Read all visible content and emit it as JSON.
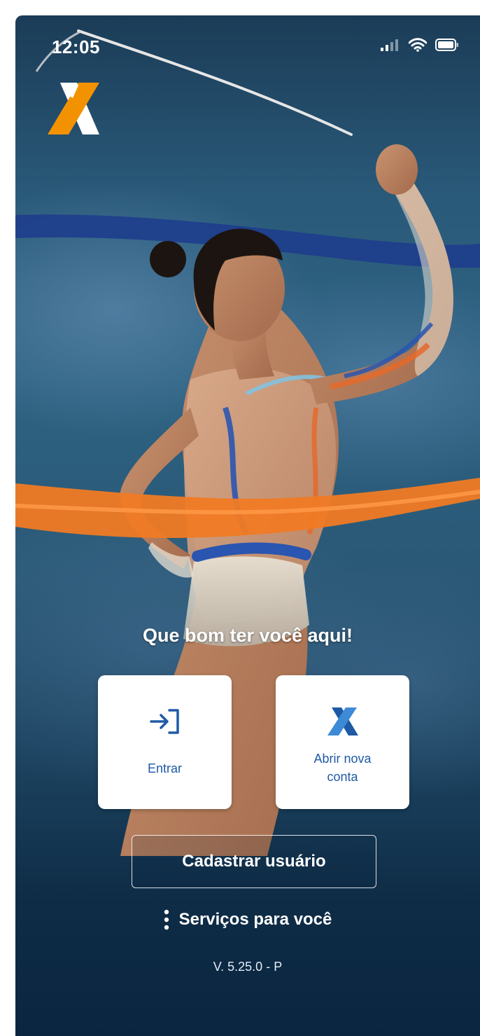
{
  "status_bar": {
    "time": "12:05",
    "icons": [
      "cellular-signal-icon",
      "wifi-icon",
      "battery-icon"
    ]
  },
  "brand": {
    "logo": "caixa-x-logo",
    "colors": {
      "logo_orange": "#f39200",
      "logo_white": "#ffffff",
      "primary_blue": "#1f5aa6",
      "ribbon_orange": "#f07a24",
      "ribbon_blue": "#1e3e8c"
    }
  },
  "main": {
    "greeting": "Que bom ter você aqui!",
    "actions": [
      {
        "label": "Entrar",
        "icon": "login-arrow-icon"
      },
      {
        "label_line1": "Abrir nova",
        "label_line2": "conta",
        "icon": "caixa-x-icon"
      }
    ],
    "register_label": "Cadastrar usuário",
    "services_label": "Serviços para você",
    "services_icon": "vertical-dots-icon",
    "version": "V. 5.25.0 - P"
  }
}
